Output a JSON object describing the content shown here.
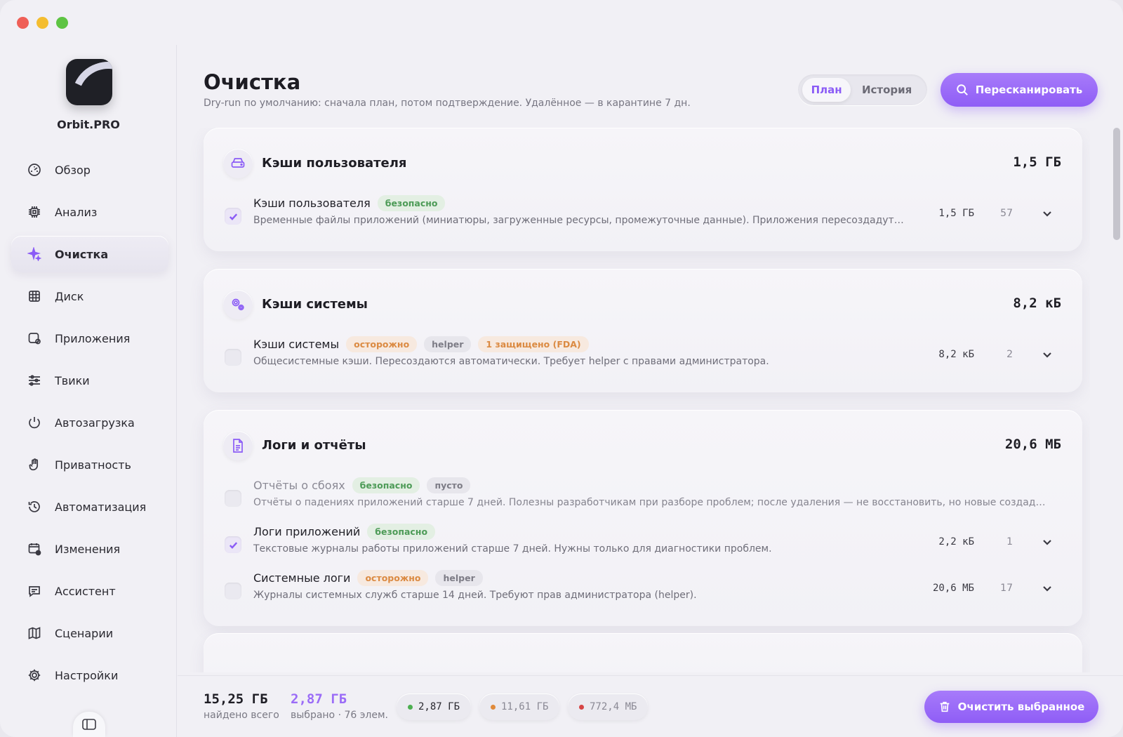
{
  "app": {
    "name": "Orbit.PRO"
  },
  "nav": [
    {
      "label": "Обзор",
      "icon": "gauge-icon",
      "active": false
    },
    {
      "label": "Анализ",
      "icon": "chip-icon",
      "active": false
    },
    {
      "label": "Очистка",
      "icon": "sparkle-icon",
      "active": true
    },
    {
      "label": "Диск",
      "icon": "grid-icon",
      "active": false
    },
    {
      "label": "Приложения",
      "icon": "app-icon",
      "active": false
    },
    {
      "label": "Твики",
      "icon": "sliders-icon",
      "active": false
    },
    {
      "label": "Автозагрузка",
      "icon": "power-icon",
      "active": false
    },
    {
      "label": "Приватность",
      "icon": "hand-icon",
      "active": false
    },
    {
      "label": "Автоматизация",
      "icon": "history-icon",
      "active": false
    },
    {
      "label": "Изменения",
      "icon": "calendar-icon",
      "active": false
    },
    {
      "label": "Ассистент",
      "icon": "chat-icon",
      "active": false
    },
    {
      "label": "Сценарии",
      "icon": "map-icon",
      "active": false
    },
    {
      "label": "Настройки",
      "icon": "gear-icon",
      "active": false
    }
  ],
  "header": {
    "title": "Очистка",
    "subtitle": "Dry-run по умолчанию: сначала план, потом подтверждение. Удалённое — в карантине 7 дн.",
    "tabs": [
      "План",
      "История"
    ],
    "active_tab": "План",
    "rescan_label": "Пересканировать"
  },
  "cards": [
    {
      "title": "Кэши пользователя",
      "size": "1,5 ГБ",
      "icon": "drive-icon",
      "rows": [
        {
          "title": "Кэши пользователя",
          "checked": true,
          "dim": false,
          "badges": [
            {
              "text": "безопасно",
              "kind": "safe"
            }
          ],
          "desc": "Временные файлы приложений (миниатюры, загруженные ресурсы, промежуточные данные). Приложения пересоздадут их пр...",
          "size": "1,5 ГБ",
          "count": "57"
        }
      ]
    },
    {
      "title": "Кэши системы",
      "size": "8,2 кБ",
      "icon": "gears-icon",
      "rows": [
        {
          "title": "Кэши системы",
          "checked": false,
          "dim": false,
          "badges": [
            {
              "text": "осторожно",
              "kind": "warn"
            },
            {
              "text": "helper",
              "kind": "grey"
            },
            {
              "text": "1 защищено (FDA)",
              "kind": "warn"
            }
          ],
          "desc": "Общесистемные кэши. Пересоздаются автоматически. Требует helper с правами администратора.",
          "size": "8,2 кБ",
          "count": "2"
        }
      ]
    },
    {
      "title": "Логи и отчёты",
      "size": "20,6 МБ",
      "icon": "document-icon",
      "rows": [
        {
          "title": "Отчёты о сбоях",
          "checked": false,
          "dim": true,
          "badges": [
            {
              "text": "безопасно",
              "kind": "safe"
            },
            {
              "text": "пусто",
              "kind": "grey"
            }
          ],
          "desc": "Отчёты о падениях приложений старше 7 дней. Полезны разработчикам при разборе проблем; после удаления — не восстановить, но новые создадутся п...",
          "size": "",
          "count": ""
        },
        {
          "title": "Логи приложений",
          "checked": true,
          "dim": false,
          "badges": [
            {
              "text": "безопасно",
              "kind": "safe"
            }
          ],
          "desc": "Текстовые журналы работы приложений старше 7 дней. Нужны только для диагностики проблем.",
          "size": "2,2 кБ",
          "count": "1"
        },
        {
          "title": "Системные логи",
          "checked": false,
          "dim": false,
          "badges": [
            {
              "text": "осторожно",
              "kind": "warn"
            },
            {
              "text": "helper",
              "kind": "grey"
            }
          ],
          "desc": "Журналы системных служб старше 14 дней. Требуют прав администратора (helper).",
          "size": "20,6 МБ",
          "count": "17"
        }
      ]
    }
  ],
  "footer": {
    "found_value": "15,25 ГБ",
    "found_label": "найдено всего",
    "selected_value": "2,87 ГБ",
    "selected_label": "выбрано · 76 элем.",
    "pills": [
      {
        "value": "2,87 ГБ",
        "color": "#4caf50",
        "muted": false
      },
      {
        "value": "11,61 ГБ",
        "color": "#e08a3a",
        "muted": true
      },
      {
        "value": "772,4 МБ",
        "color": "#d64545",
        "muted": true
      }
    ],
    "clear_label": "Очистить выбранное"
  }
}
